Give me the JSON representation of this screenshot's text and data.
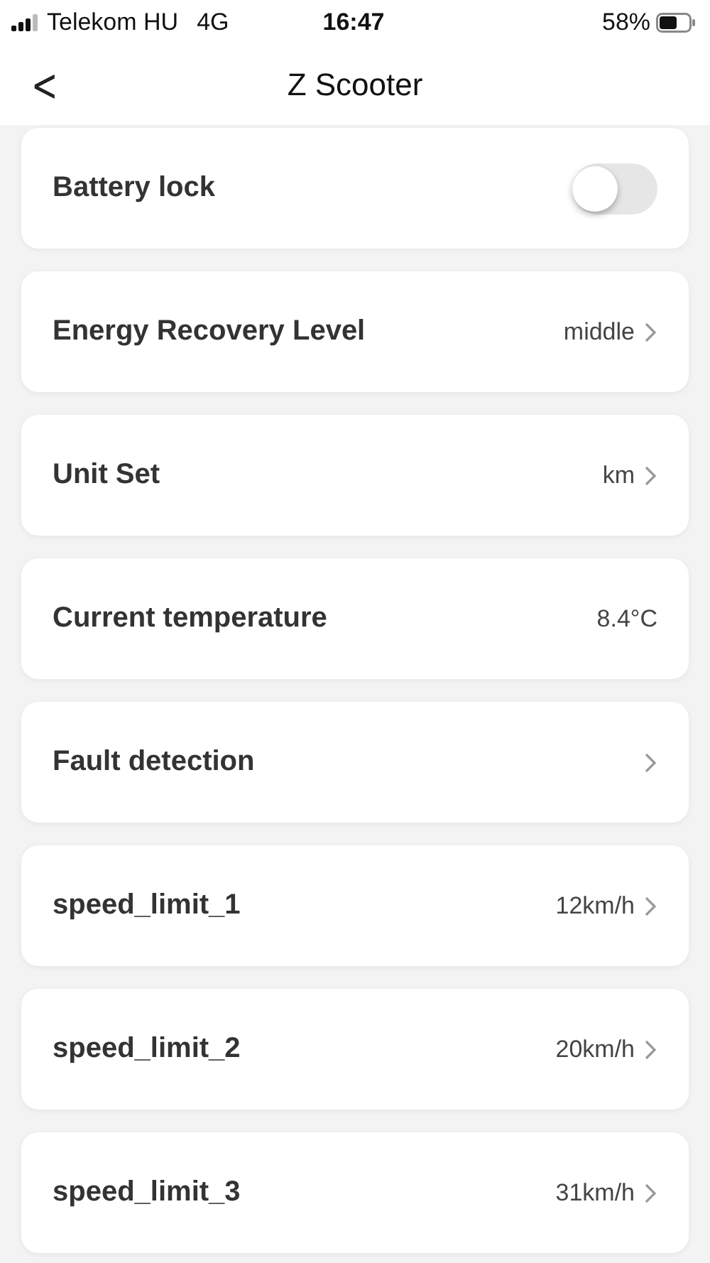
{
  "status_bar": {
    "carrier": "Telekom HU",
    "network": "4G",
    "time": "16:47",
    "battery": "58%"
  },
  "header": {
    "back": "<",
    "title": "Z Scooter"
  },
  "settings": [
    {
      "kind": "toggle",
      "label": "Battery lock",
      "on": false
    },
    {
      "kind": "link",
      "label": "Energy Recovery Level",
      "value": "middle"
    },
    {
      "kind": "link",
      "label": "Unit Set",
      "value": "km"
    },
    {
      "kind": "info",
      "label": "Current temperature",
      "value": "8.4°C"
    },
    {
      "kind": "link",
      "label": "Fault detection"
    },
    {
      "kind": "link",
      "label": "speed_limit_1",
      "value": "12km/h"
    },
    {
      "kind": "link",
      "label": "speed_limit_2",
      "value": "20km/h"
    },
    {
      "kind": "link",
      "label": "speed_limit_3",
      "value": "31km/h"
    }
  ]
}
